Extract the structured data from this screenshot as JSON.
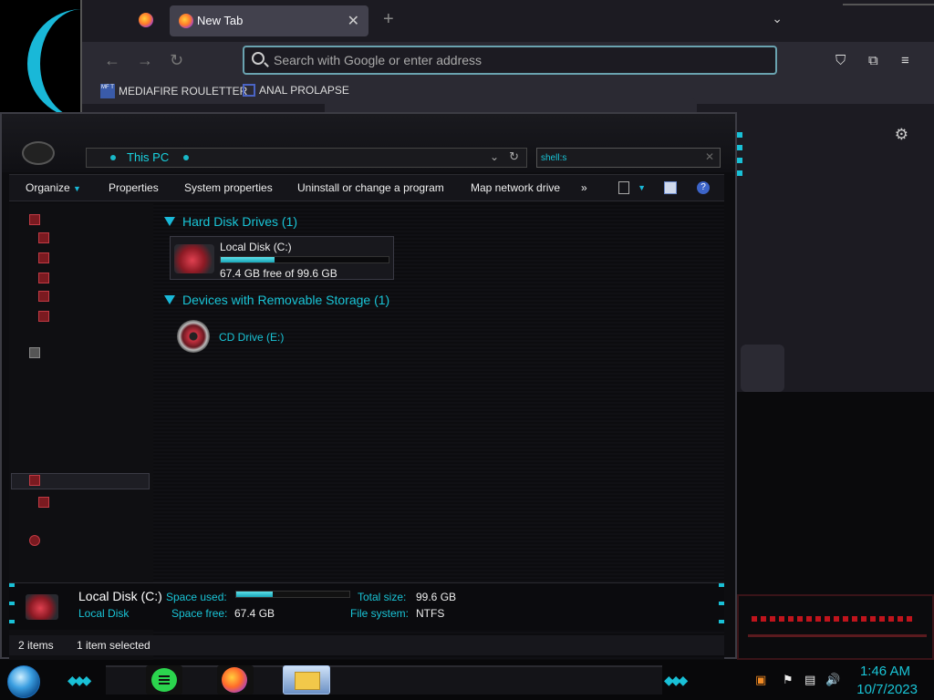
{
  "firefox": {
    "tab_title": "New Tab",
    "tab_close": "✕",
    "new_tab": "+",
    "tabs_list": "⌄",
    "nav": {
      "back": "←",
      "forward": "→",
      "reload": "↻"
    },
    "url_placeholder": "Search with Google or enter address",
    "bookmarks": [
      {
        "icon_text": "MF T",
        "label": "MEDIAFIRE ROULETTER"
      },
      {
        "label": "ANAL PROLAPSE"
      }
    ],
    "tools": {
      "pocket": "⛉",
      "extensions": "⧉",
      "menu": "≡"
    },
    "settings": "⚙"
  },
  "explorer": {
    "address": "This PC",
    "address_chev": "⌄",
    "address_refresh": "↻",
    "search_value": "shell:s",
    "search_clear": "✕",
    "toolbar": {
      "organize": "Organize",
      "organize_arrow": "▼",
      "properties": "Properties",
      "system_properties": "System properties",
      "uninstall": "Uninstall or change a program",
      "map_drive": "Map network drive",
      "more": "»",
      "views_arrow": "▼",
      "help": "?"
    },
    "groups": {
      "hdd": "Hard Disk Drives (1)",
      "removable": "Devices with Removable Storage (1)"
    },
    "drive": {
      "name": "Local Disk (C:)",
      "free_text": "67.4 GB free of 99.6 GB",
      "used_fraction": 0.32
    },
    "cd": {
      "label": "CD Drive (E:)"
    },
    "details": {
      "title": "Local Disk (C:)",
      "subtitle": "Local Disk",
      "space_used_label": "Space used:",
      "space_free_label": "Space free:",
      "space_free_value": "67.4 GB",
      "total_size_label": "Total size:",
      "total_size_value": "99.6 GB",
      "file_system_label": "File system:",
      "file_system_value": "NTFS"
    },
    "status": {
      "items": "2 items",
      "selected": "1 item selected"
    }
  },
  "taskbar": {
    "tray": {
      "flag": "⚑",
      "volume": "🔊"
    },
    "time": "1:46 AM",
    "date": "10/7/2023"
  },
  "colors": {
    "accent": "#19c4d6",
    "red": "#c0141c"
  }
}
